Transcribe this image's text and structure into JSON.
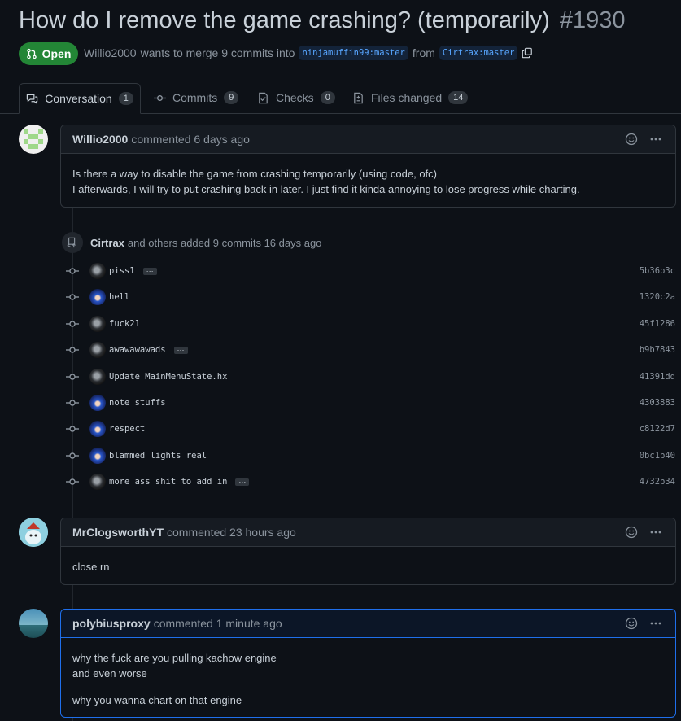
{
  "pr": {
    "title": "How do I remove the game crashing? (temporarily)",
    "number": "#1930",
    "state": "Open",
    "author": "Willio2000",
    "merge_text": "wants to merge 9 commits into",
    "base_branch": "ninjamuffin99:master",
    "from_text": "from",
    "head_branch": "Cirtrax:master"
  },
  "tabs": [
    {
      "label": "Conversation",
      "count": "1",
      "icon": "comment-discussion-icon"
    },
    {
      "label": "Commits",
      "count": "9",
      "icon": "git-commit-icon"
    },
    {
      "label": "Checks",
      "count": "0",
      "icon": "checklist-icon"
    },
    {
      "label": "Files changed",
      "count": "14",
      "icon": "file-diff-icon"
    }
  ],
  "comments": [
    {
      "author": "Willio2000",
      "action": "commented 6 days ago",
      "lines": [
        "Is there a way to disable the game from crashing temporarily (using code, ofc)",
        "I afterwards, I will try to put crashing back in later. I just find it kinda annoying to lose progress while charting."
      ]
    },
    {
      "author": "MrClogsworthYT",
      "action": "commented 23 hours ago",
      "lines": [
        "close rn"
      ]
    },
    {
      "author": "polybiusproxy",
      "action": "commented 1 minute ago",
      "lines": [
        "why the fuck are you pulling kachow engine",
        "and even worse",
        "why you wanna chart on that engine"
      ]
    }
  ],
  "push_event": {
    "author": "Cirtrax",
    "text": "and others added 9 commits 16 days ago"
  },
  "commits": [
    {
      "message": "piss1",
      "sha": "5b36b3c",
      "has_more": true,
      "avatar": "dark"
    },
    {
      "message": "hell",
      "sha": "1320c2a",
      "has_more": false,
      "avatar": "blue"
    },
    {
      "message": "fuck21",
      "sha": "45f1286",
      "has_more": false,
      "avatar": "dark"
    },
    {
      "message": "awawawawads",
      "sha": "b9b7843",
      "has_more": true,
      "avatar": "dark"
    },
    {
      "message": "Update MainMenuState.hx",
      "sha": "41391dd",
      "has_more": false,
      "avatar": "dark"
    },
    {
      "message": "note stuffs",
      "sha": "4303883",
      "has_more": false,
      "avatar": "blue"
    },
    {
      "message": "respect",
      "sha": "c8122d7",
      "has_more": false,
      "avatar": "blue"
    },
    {
      "message": "blammed lights real",
      "sha": "0bc1b40",
      "has_more": false,
      "avatar": "blue"
    },
    {
      "message": "more ass shit to add in",
      "sha": "4732b34",
      "has_more": true,
      "avatar": "dark"
    }
  ],
  "more_glyph": "···",
  "colors": {
    "background": "#0d1117",
    "open_state": "#238636",
    "link_blue": "#58a6ff",
    "border": "#30363d",
    "muted": "#8b949e"
  }
}
